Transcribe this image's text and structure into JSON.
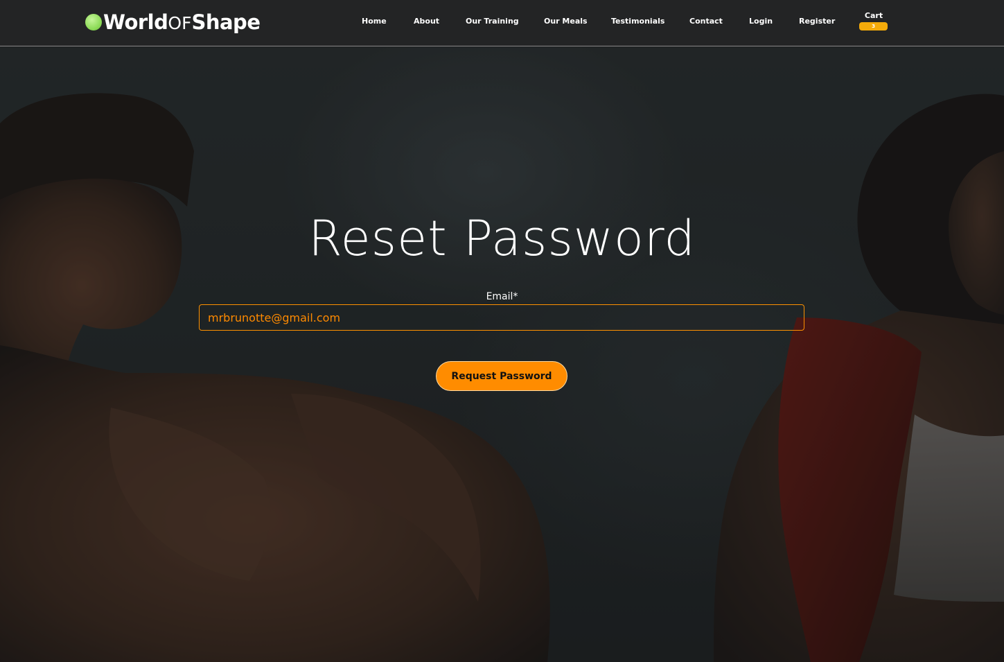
{
  "brand": {
    "part1": "World",
    "part2": "OF",
    "part3": "Shape"
  },
  "nav": {
    "home": "Home",
    "about": "About",
    "training": "Our Training",
    "meals": "Our Meals",
    "testimonials": "Testimonials",
    "contact": "Contact",
    "login": "Login",
    "register": "Register"
  },
  "cart": {
    "label": "Cart",
    "count": "3"
  },
  "form": {
    "title": "Reset Password",
    "email_label": "Email*",
    "email_value": "mrbrunotte@gmail.com",
    "submit_label": "Request Password"
  },
  "colors": {
    "accent": "#ff8c00",
    "badge": "#f5ab0a",
    "brand_dot": "#8fdc5a",
    "navbar": "#232425"
  }
}
